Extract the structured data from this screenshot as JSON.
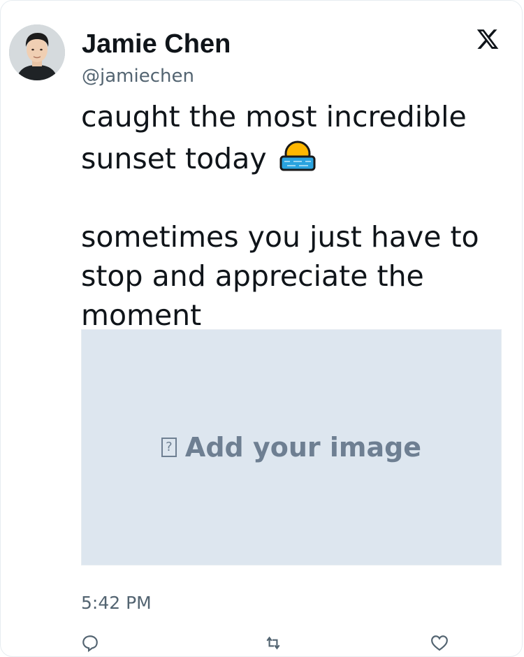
{
  "author": {
    "display_name": "Jamie Chen",
    "handle": "@jamiechen"
  },
  "tweet": {
    "line1": "caught the most incredible",
    "line2": "sunset today",
    "emoji": "sunrise-over-water",
    "line3": "sometimes you just have to",
    "line4": "stop and appreciate the",
    "line5": "moment"
  },
  "media": {
    "glyph": "?",
    "placeholder": "Add your image"
  },
  "timestamp": "5:42 PM",
  "icons": {
    "brand": "x-logo-icon",
    "reply": "reply-icon",
    "repost": "repost-icon",
    "like": "heart-icon"
  },
  "colors": {
    "text": "#0f1419",
    "secondary": "#536471",
    "media_bg": "#dde6ef",
    "media_text": "#6e7f92"
  }
}
